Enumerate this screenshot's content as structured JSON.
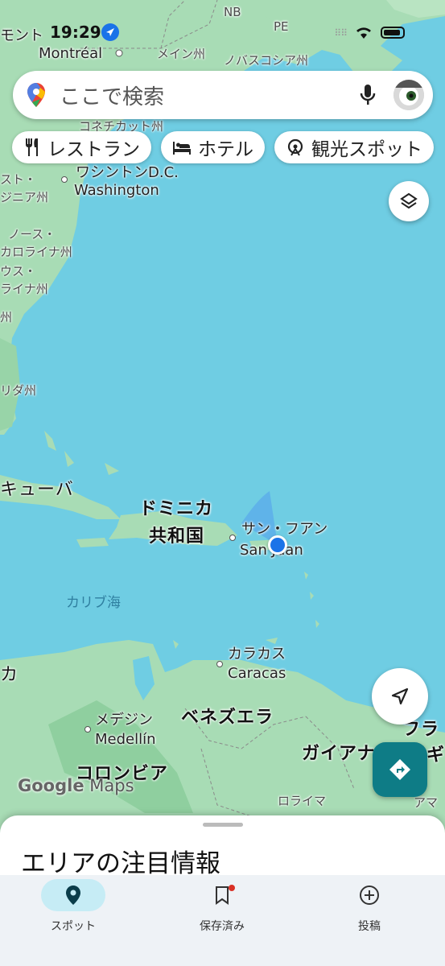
{
  "status_bar": {
    "time": "19:29"
  },
  "search": {
    "placeholder": "ここで検索"
  },
  "chips": [
    {
      "label": "レストラン",
      "icon": "restaurant-icon"
    },
    {
      "label": "ホテル",
      "icon": "hotel-icon"
    },
    {
      "label": "観光スポット",
      "icon": "attraction-icon"
    }
  ],
  "map_labels": {
    "nb": "NB",
    "pe": "PE",
    "montreal_partial": "モント",
    "montreal": "Montréal",
    "maine": "メイン州",
    "nova_scotia": "ノバスコシア州",
    "connecticut": "コネチカット州",
    "washington_jp": "ワシントンD.C.",
    "washington": "Washington",
    "west_virginia_1": "スト・",
    "west_virginia_2": "ジニア州",
    "nc_1": "ノース・",
    "nc_2": "カロライナ州",
    "sc_1": "ウス・",
    "sc_2": "ライナ州",
    "ga": "州",
    "florida": "リダ州",
    "cuba": "キューバ",
    "dominican_1": "ドミニカ",
    "dominican_2": "共和国",
    "san_juan_jp": "サン・フアン",
    "san_juan": "San Juan",
    "caribbean": "カリブ海",
    "caracas_jp": "カラカス",
    "caracas": "Caracas",
    "medellin_jp": "メデジン",
    "medellin": "Medellín",
    "venezuela": "ベネズエラ",
    "colombia": "コロンビア",
    "guyana": "ガイアナ",
    "roraima": "ロライマ",
    "amapa": "アマ",
    "fr_1": "フラ",
    "fr_2": "ギ",
    "left_edge": "カ"
  },
  "attribution": {
    "google": "Google",
    "maps": "Maps"
  },
  "sheet": {
    "title": "エリアの注目情報"
  },
  "bottom_nav": [
    {
      "label": "スポット",
      "icon": "location-pin-icon",
      "active": true
    },
    {
      "label": "保存済み",
      "icon": "bookmark-icon",
      "active": false,
      "badge": true
    },
    {
      "label": "投稿",
      "icon": "add-circle-icon",
      "active": false
    }
  ],
  "colors": {
    "water": "#6fcde3",
    "land": "#a8dcb5",
    "accent": "#0e7c86",
    "location": "#1a73e8"
  }
}
